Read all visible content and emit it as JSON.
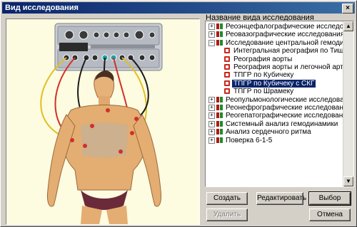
{
  "window": {
    "title": "Вид исследования",
    "close_glyph": "×"
  },
  "list": {
    "label": "Название вида исследования",
    "items": [
      {
        "label": "Реоэнцефалографические исследования",
        "level": 0,
        "expander": "+"
      },
      {
        "label": "Реовазографические исследования",
        "level": 0,
        "expander": "+"
      },
      {
        "label": "Исследование центральной гемодинамики",
        "level": 0,
        "expander": "−"
      },
      {
        "label": "Интегральная реография по Тищенко",
        "level": 1
      },
      {
        "label": "Реография аорты",
        "level": 1
      },
      {
        "label": "Реография аорты и легочной артерии",
        "level": 1
      },
      {
        "label": "ТПГР по Кубичеку",
        "level": 1
      },
      {
        "label": "ТПГР по Кубичеку с СКГ",
        "level": 1,
        "selected": true
      },
      {
        "label": "ТПГР по Шрамеку",
        "level": 1
      },
      {
        "label": "Реопульмонологические исследования",
        "level": 0,
        "expander": "+"
      },
      {
        "label": "Реонефрографические исследования",
        "level": 0,
        "expander": "+"
      },
      {
        "label": "Реогепатографические исследования",
        "level": 0,
        "expander": "+"
      },
      {
        "label": "Системный анализ гемодинамики",
        "level": 0,
        "expander": "+"
      },
      {
        "label": "Анализ сердечного ритма",
        "level": 0,
        "expander": "+"
      },
      {
        "label": "Поверка 6-1-5",
        "level": 0,
        "expander": "+"
      }
    ]
  },
  "buttons": {
    "create": "Создать",
    "edit": "Редактировать",
    "select": "Выбор",
    "delete": "Удалить",
    "cancel": "Отмена"
  },
  "colors": {
    "title_start": "#0a246a",
    "title_end": "#3a6ea5",
    "selection": "#0a246a",
    "picture_bg": "#fdfbe0"
  },
  "icons": {
    "group": "book-icon",
    "item": "document-icon"
  }
}
